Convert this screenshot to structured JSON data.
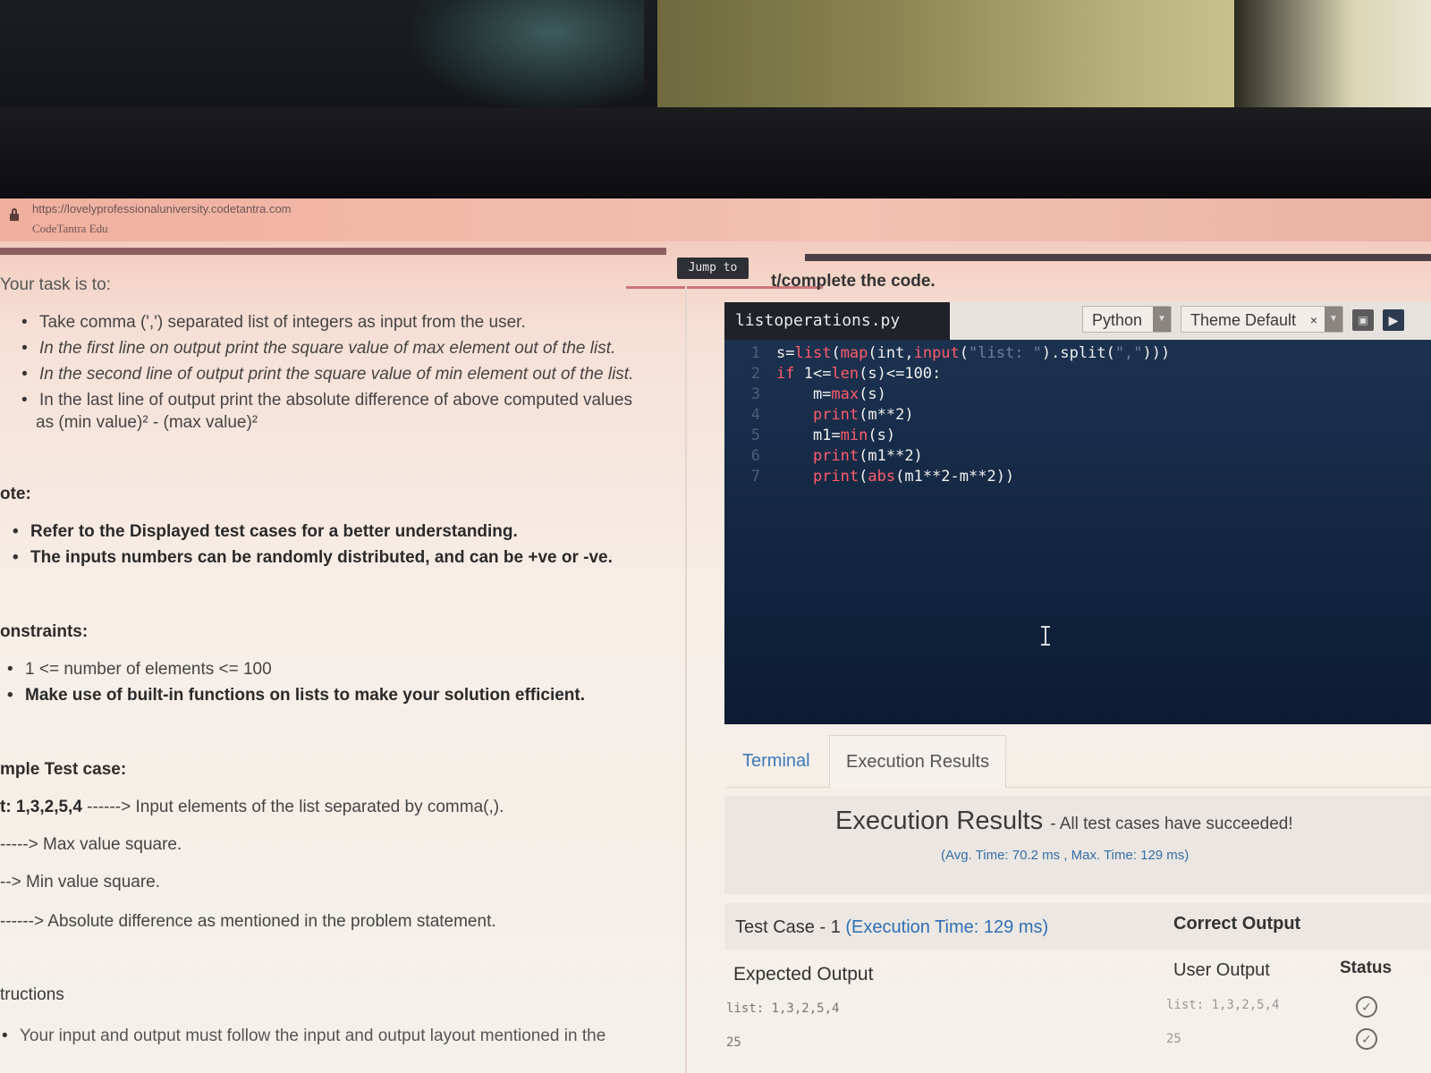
{
  "browser": {
    "url": "https://lovelyprofessionaluniversity.codetantra.com",
    "site_name": "CodeTantra Edu"
  },
  "toolbar": {
    "jump_label": "Jump to"
  },
  "problem": {
    "task_heading": "Your task is to:",
    "task_items": [
      "Take comma (',') separated list of integers as input from the user.",
      "In the first line on output print the square value of max element out of the list.",
      "In the second line of output print the square value of min element out of the list.",
      "In the last line of output print the absolute difference of above computed values",
      "as (min value)² - (max value)²"
    ],
    "note_heading": "ote:",
    "note_items": [
      "Refer to the Displayed test cases for a better understanding.",
      "The inputs numbers can be randomly distributed, and can be +ve or -ve."
    ],
    "constraints_heading": "onstraints:",
    "constraint_items": [
      "1 <= number of elements <= 100",
      "Make use of built-in functions on lists to make your solution efficient."
    ],
    "sample_heading": "mple Test case:",
    "sample_input_prefix": "t: 1,3,2,5,4",
    "sample_input_desc": "------> Input elements of the list separated by comma(,).",
    "sample_line2": "-----> Max value square.",
    "sample_line3": "--> Min value square.",
    "sample_line4": "------> Absolute difference as mentioned in the problem statement.",
    "instructions_heading": "tructions",
    "instructions_item": "Your input and output must follow the input and output layout mentioned in the"
  },
  "editor": {
    "instruction": "t/complete the code.",
    "filename": "listoperations.py",
    "language": "Python",
    "theme": "Theme Default",
    "line_numbers": [
      "1",
      "2",
      "3",
      "4",
      "5",
      "6",
      "7"
    ]
  },
  "results": {
    "tab_terminal": "Terminal",
    "tab_execution": "Execution Results",
    "title": "Execution Results",
    "subtitle": "- All test cases have succeeded!",
    "meta": "(Avg. Time: 70.2 ms , Max. Time: 129 ms)",
    "testcase_label": "Test Case - 1",
    "testcase_time": "(Execution Time: 129 ms)",
    "correct_output": "Correct Output",
    "expected_output": "Expected Output",
    "user_output": "User Output",
    "status": "Status",
    "expected_line1": "list: 1,3,2,5,4",
    "expected_line2": "25",
    "user_line1": "list: 1,3,2,5,4",
    "user_line2": "25"
  }
}
